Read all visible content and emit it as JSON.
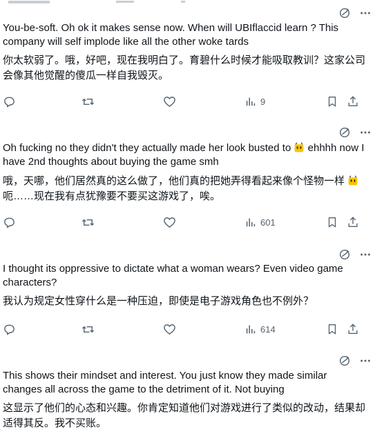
{
  "tweets": [
    {
      "en": "You-be-soft.  Oh ok it makes sense now. When will UBIflaccid learn ? This company will self implode like all the other woke tards",
      "zh": "你太软弱了。哦，好吧，现在我明白了。育碧什么时候才能吸取教训？这家公司会像其他觉醒的傻瓜一样自我毁灭。",
      "views": "9"
    },
    {
      "en_part1": "Oh fucking no they didn't they actually made her look busted to",
      "en_part2": "ehhhh now I have 2nd thoughts about buying the game smh",
      "zh_part1": "哦，天哪，他们居然真的这么做了，他们真的把她弄得看起来像个怪物一样",
      "zh_part2": "呃……现在我有点犹豫要不要买这游戏了，唉。",
      "views": "601"
    },
    {
      "en": "I thought its oppressive to dictate what a woman wears? Even video game characters?",
      "zh": "我认为规定女性穿什么是一种压迫，即使是电子游戏角色也不例外？",
      "views": "614"
    },
    {
      "en": "This shows their mindset and interest.  You just know they made similar changes all across the game to the detriment of it. Not buying",
      "zh": "这显示了他们的心态和兴趣。你肯定知道他们对游戏进行了类似的改动，结果却适得其反。我不买账。"
    }
  ],
  "icons": {
    "translate": "translate-icon",
    "more": "more-icon",
    "reply": "reply-icon",
    "retweet": "retweet-icon",
    "like": "like-icon",
    "views": "views-icon",
    "bookmark": "bookmark-icon",
    "share": "share-icon",
    "emoji": "face-emoji"
  },
  "colors": {
    "text": "#0f1419",
    "secondary": "#536471",
    "emoji": "#f5c400"
  }
}
